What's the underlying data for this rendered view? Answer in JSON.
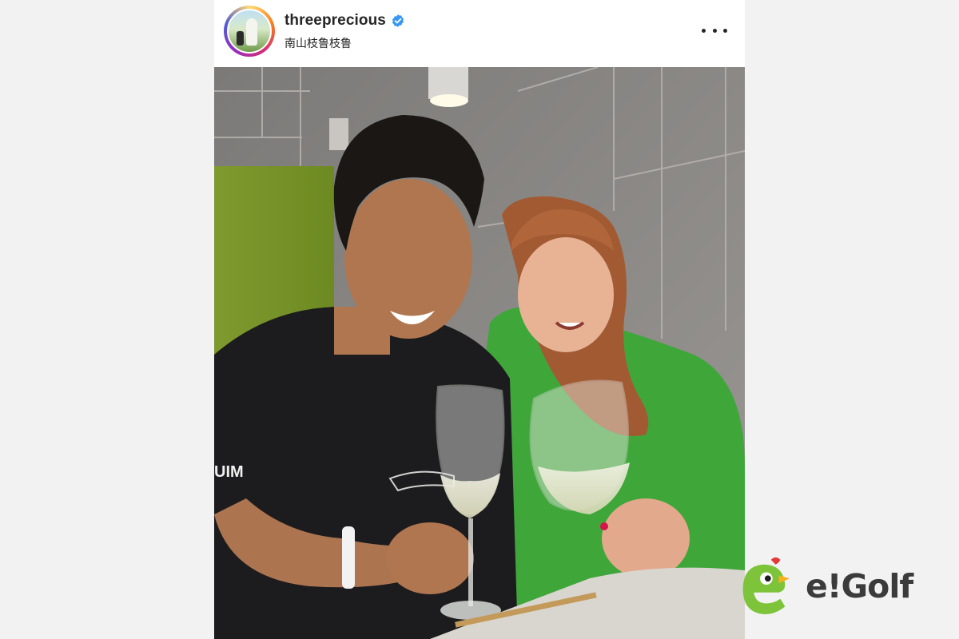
{
  "post": {
    "username": "threeprecious",
    "verified": true,
    "subtitle": "南山枝鲁枝鲁",
    "more_icon": "more-horizontal-icon",
    "shirt_print": "UIM"
  },
  "watermark": {
    "brand": "e!Golf",
    "mascot_icon": "green-bird-mascot-icon"
  },
  "colors": {
    "verified_blue": "#3897f0",
    "brand_green": "#7dc43a",
    "text_dark": "#262626"
  }
}
